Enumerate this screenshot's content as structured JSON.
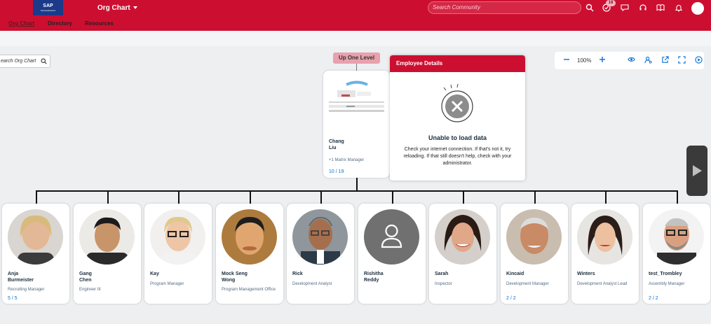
{
  "header": {
    "logo_text": "SAP",
    "logo_sub": "SuccessFactors",
    "app_title": "Org Chart",
    "search_placeholder": "Search Community",
    "notification_badge": "18",
    "brand_color": "#cc0f30"
  },
  "nav": {
    "items": [
      {
        "label": "Org Chart"
      },
      {
        "label": "Directory"
      },
      {
        "label": "Resources"
      }
    ]
  },
  "search_org": {
    "placeholder": "earch Org Chart"
  },
  "toolbar": {
    "zoom": "100%"
  },
  "up_one_label": "Up One Level",
  "manager": {
    "name_line1": "Chang",
    "name_line2": "Liu",
    "subtitle": "+1 Matrix Manager",
    "count": "10 / 19"
  },
  "details": {
    "title": "Employee Details",
    "error_title": "Unable to load data",
    "error_message": "Check your internet connection. If that's not it, try reloading. If that still doesn't help, check with your administrator."
  },
  "reports": [
    {
      "name1": "Anja",
      "name2": "Burmeister",
      "title": "Recruiting Manager",
      "count": "5 / 5",
      "photo": "woman-blonde"
    },
    {
      "name1": "Gang",
      "name2": "Chen",
      "title": "Engineer III",
      "count": "",
      "photo": "man-asian"
    },
    {
      "name1": "Kay",
      "name2": "",
      "title": "Program Manager",
      "count": "",
      "photo": "woman-glasses"
    },
    {
      "name1": "Mock Seng",
      "name2": "Wong",
      "title": "Program Management Office",
      "count": "",
      "photo": "man-young"
    },
    {
      "name1": "Rick",
      "name2": "",
      "title": "Development Analyst",
      "count": "",
      "photo": "man-headset"
    },
    {
      "name1": "Rishitha",
      "name2": "Reddy",
      "title": "",
      "count": "",
      "photo": "placeholder"
    },
    {
      "name1": "Sarah",
      "name2": "",
      "title": "Inspector",
      "count": "",
      "photo": "woman-dark"
    },
    {
      "name1": "Kincaid",
      "name2": "",
      "title": "Development Manager",
      "count": "2 / 2",
      "photo": "man-older"
    },
    {
      "name1": "Winters",
      "name2": "",
      "title": "Development Analyst Lead",
      "count": "",
      "photo": "woman-brunette"
    },
    {
      "name1": "test_Trombley",
      "name2": "",
      "title": "Assembly Manager",
      "count": "2 / 2",
      "photo": "man-beard"
    }
  ]
}
